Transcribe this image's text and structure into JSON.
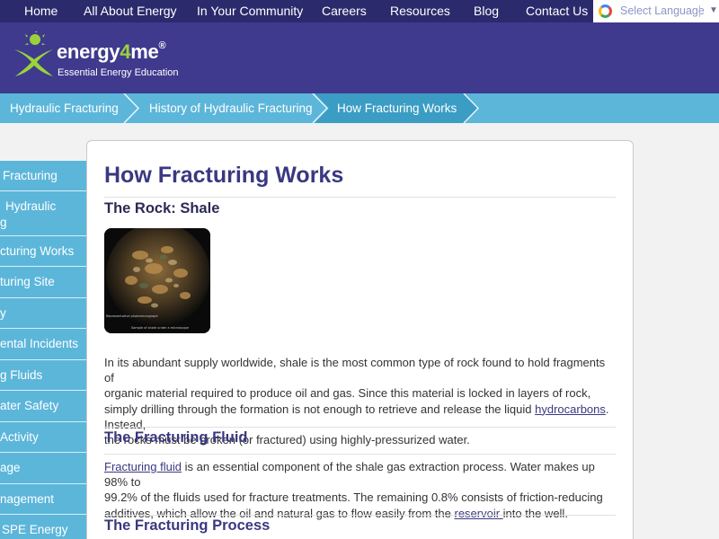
{
  "nav": {
    "items": [
      "Home",
      "All About Energy",
      "In Your Community",
      "Careers",
      "Resources",
      "Blog",
      "Contact Us"
    ],
    "translate_label": "Select Language",
    "translate_separator": "|",
    "translate_arrow": "▼"
  },
  "header": {
    "logo_name_a": "energy",
    "logo_name_b": "4",
    "logo_name_c": "me",
    "logo_reg": "®",
    "tagline": "Essential Energy Education"
  },
  "breadcrumb": [
    "Hydraulic Fracturing",
    "History of Hydraulic Fracturing",
    "How Fracturing Works"
  ],
  "sidebar": {
    "items": [
      {
        "lines": [
          "Fracturing"
        ]
      },
      {
        "lines": [
          "Hydraulic",
          "g"
        ]
      },
      {
        "lines": [
          "cturing Works"
        ]
      },
      {
        "lines": [
          "turing Site"
        ]
      },
      {
        "lines": [
          "y"
        ]
      },
      {
        "lines": [
          "ental Incidents"
        ]
      },
      {
        "lines": [
          "g Fluids"
        ]
      },
      {
        "lines": [
          "ater Safety"
        ]
      },
      {
        "lines": [
          "Activity"
        ]
      },
      {
        "lines": [
          "age"
        ]
      },
      {
        "lines": [
          "nagement"
        ]
      },
      {
        "lines": [
          "SPE Energy"
        ]
      }
    ]
  },
  "content": {
    "title": "How Fracturing Works",
    "section1_title": "The Rock: Shale",
    "photo_caption_left": "Representative photomicrograph",
    "photo_caption_bottom": "Sample of shale under a microscope",
    "para1": {
      "l1": "In its abundant supply worldwide, shale is the most common type of rock found to hold fragments of",
      "l2": "organic material required to produce oil and gas. Since this material is locked in layers of rock,",
      "l3a": "simply drilling through the formation is not enough to retrieve and release the liquid ",
      "l3link": "hydrocarbons",
      "l3b": ". Instead,",
      "l4": "the rocks must be broken (or fractured) using highly-pressurized water."
    },
    "section2_title": "The Fracturing Fluid",
    "para2": {
      "l1link": "Fracturing fluid",
      "l1b": " is an essential component of the shale gas extraction process. Water makes up 98% to",
      "l2": "99.2% of the fluids used for fracture treatments. The remaining 0.8% consists of friction-reducing",
      "l3a": "additives, which allow the oil and natural gas to flow easily from the ",
      "l3link": "reservoir ",
      "l3b": "into the well."
    },
    "section3_title": "The Fracturing Process"
  },
  "colors": {
    "nav_bg": "#2b2a6c",
    "header_bg": "#3f3a8d",
    "breadcrumb_bg": "#5cb6da",
    "breadcrumb_active_bg": "#3b9dc4",
    "accent_green": "#9bd23c",
    "link": "#3a3880"
  }
}
